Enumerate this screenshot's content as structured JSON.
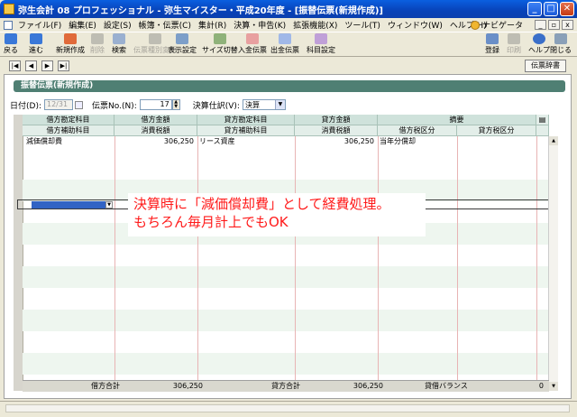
{
  "window": {
    "title": "弥生会計 08 プロフェッショナル - 弥生マイスター・平成20年度 - [振替伝票(新規作成)]",
    "controls": {
      "minimize": "_",
      "maximize": "□",
      "close": "✕"
    }
  },
  "menu": {
    "items": [
      "ファイル(F)",
      "編集(E)",
      "設定(S)",
      "帳簿・伝票(C)",
      "集計(R)",
      "決算・申告(K)",
      "拡張機能(X)",
      "ツール(T)",
      "ウィンドウ(W)",
      "ヘルプ(H)"
    ],
    "navi_label": "ナビゲータ"
  },
  "toolbar": {
    "left": [
      {
        "label": "戻る",
        "icon": "back-arrow-icon",
        "enabled": true
      },
      {
        "label": "進む",
        "icon": "forward-arrow-icon",
        "enabled": true
      },
      {
        "label": "新規作成",
        "icon": "new-doc-icon",
        "enabled": true
      },
      {
        "label": "削除",
        "icon": "delete-icon",
        "enabled": false
      },
      {
        "label": "検索",
        "icon": "search-icon",
        "enabled": true
      },
      {
        "label": "伝票種別変更",
        "icon": "slip-type-icon",
        "enabled": false
      },
      {
        "label": "表示設定",
        "icon": "display-settings-icon",
        "enabled": true
      },
      {
        "label": "サイズ切替",
        "icon": "size-toggle-icon",
        "enabled": true
      },
      {
        "label": "入金伝票",
        "icon": "deposit-slip-icon",
        "enabled": true
      },
      {
        "label": "出金伝票",
        "icon": "payment-slip-icon",
        "enabled": true
      },
      {
        "label": "科目設定",
        "icon": "account-settings-icon",
        "enabled": true
      }
    ],
    "right": [
      {
        "label": "登録",
        "icon": "register-icon",
        "enabled": true
      },
      {
        "label": "印刷",
        "icon": "print-icon",
        "enabled": false
      },
      {
        "label": "ヘルプ",
        "icon": "help-icon",
        "enabled": true
      },
      {
        "label": "閉じる",
        "icon": "close-doc-icon",
        "enabled": true
      }
    ]
  },
  "nav": {
    "buttons": [
      "|◀",
      "◀",
      "▶",
      "▶|"
    ],
    "dictionary_button": "伝票辞書"
  },
  "form": {
    "heading": "振替伝票(新規作成)",
    "date_label": "日付(D):",
    "date_value": "12/31",
    "slip_no_label": "伝票No.(N):",
    "slip_no_value": "17",
    "closing_label": "決算仕訳(V):",
    "closing_value": "決算"
  },
  "table": {
    "header_row1": [
      "借方勘定科目",
      "借方金額",
      "貸方勘定科目",
      "貸方金額",
      "摘要"
    ],
    "header_row2": [
      "借方補助科目",
      "消費税額",
      "貸方補助科目",
      "消費税額",
      "借方税区分",
      "貸方税区分"
    ],
    "rows": [
      {
        "debit_account": "減価償却費",
        "debit_amount": "306,250",
        "credit_account": "リース資産",
        "credit_amount": "306,250",
        "memo": "当年分償却"
      }
    ],
    "footer": {
      "debit_total_label": "借方合計",
      "debit_total": "306,250",
      "credit_total_label": "貸方合計",
      "credit_total": "306,250",
      "balance_label": "貸借バランス",
      "balance": "0"
    }
  },
  "annotation": {
    "line1": "決算時に「減価償却費」として経費処理。",
    "line2": "もちろん毎月計上でもOK",
    "color": "#ff1a1a"
  }
}
